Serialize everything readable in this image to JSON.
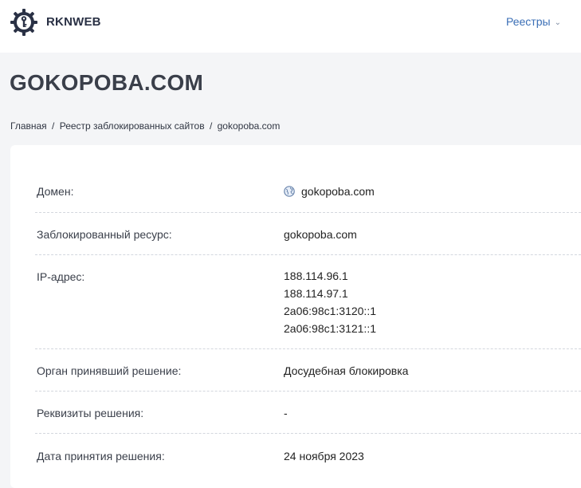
{
  "header": {
    "brand": "RKNWEB",
    "nav_registries": "Реестры",
    "chevron_glyph": "⌄"
  },
  "page": {
    "title": "GOKOPOBA.COM"
  },
  "breadcrumb": {
    "home": "Главная",
    "registry": "Реестр заблокированных сайтов",
    "current": "gokopoba.com",
    "separator": "/"
  },
  "details": {
    "domain": {
      "label": "Домен:",
      "value": "gokopoba.com",
      "icon": "globe-icon"
    },
    "blocked_resource": {
      "label": "Заблокированный ресурс:",
      "value": "gokopoba.com"
    },
    "ip": {
      "label": "IP-адрес:",
      "values": [
        "188.114.96.1",
        "188.114.97.1",
        "2a06:98c1:3120::1",
        "2a06:98c1:3121::1"
      ]
    },
    "authority": {
      "label": "Орган принявший решение:",
      "value": "Досудебная блокировка"
    },
    "requisites": {
      "label": "Реквизиты решения:",
      "value": "-"
    },
    "decision_date": {
      "label": "Дата принятия решения:",
      "value": "24 ноября 2023"
    }
  },
  "colors": {
    "brand_dark": "#2a3145",
    "link_blue": "#3b6fb6",
    "page_bg": "#f4f5f7"
  }
}
